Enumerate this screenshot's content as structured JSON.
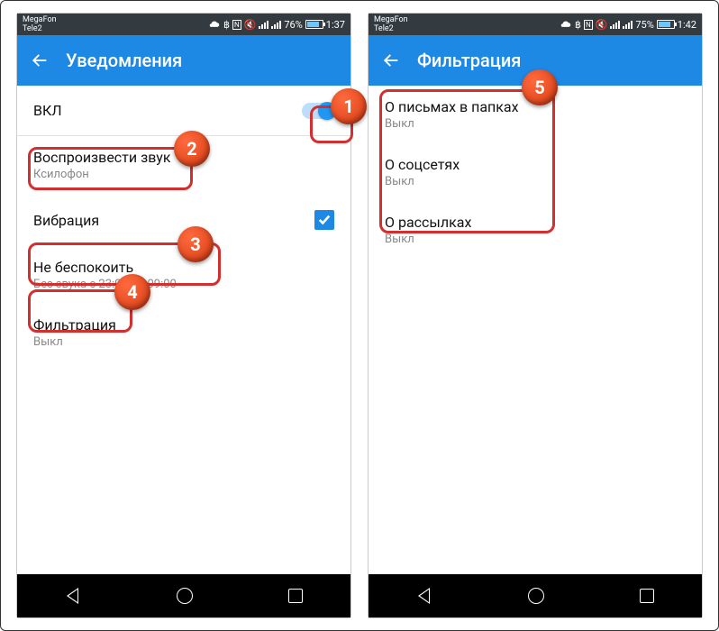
{
  "status": {
    "carrier1": "MegaFon",
    "carrier2": "Tele2",
    "battery_left": "76%",
    "time_left": "1:37",
    "battery_right": "75%",
    "time_right": "1:42"
  },
  "left": {
    "title": "Уведомления",
    "rows": {
      "enable": {
        "title": "ВКЛ"
      },
      "sound": {
        "title": "Воспроизвести звук",
        "sub": "Ксилофон"
      },
      "vibration": {
        "title": "Вибрация"
      },
      "dnd": {
        "title": "Не беспокоить",
        "sub": "Без звука с 23:00 до 09:00"
      },
      "filter": {
        "title": "Фильтрация",
        "sub": "Выкл"
      }
    }
  },
  "right": {
    "title": "Фильтрация",
    "rows": {
      "folders": {
        "title": "О письмах в папках",
        "sub": "Выкл"
      },
      "social": {
        "title": "О соцсетях",
        "sub": "Выкл"
      },
      "newsletters": {
        "title": "О рассылках",
        "sub": "Выкл"
      }
    }
  },
  "markers": {
    "m1": "1",
    "m2": "2",
    "m3": "3",
    "m4": "4",
    "m5": "5"
  }
}
